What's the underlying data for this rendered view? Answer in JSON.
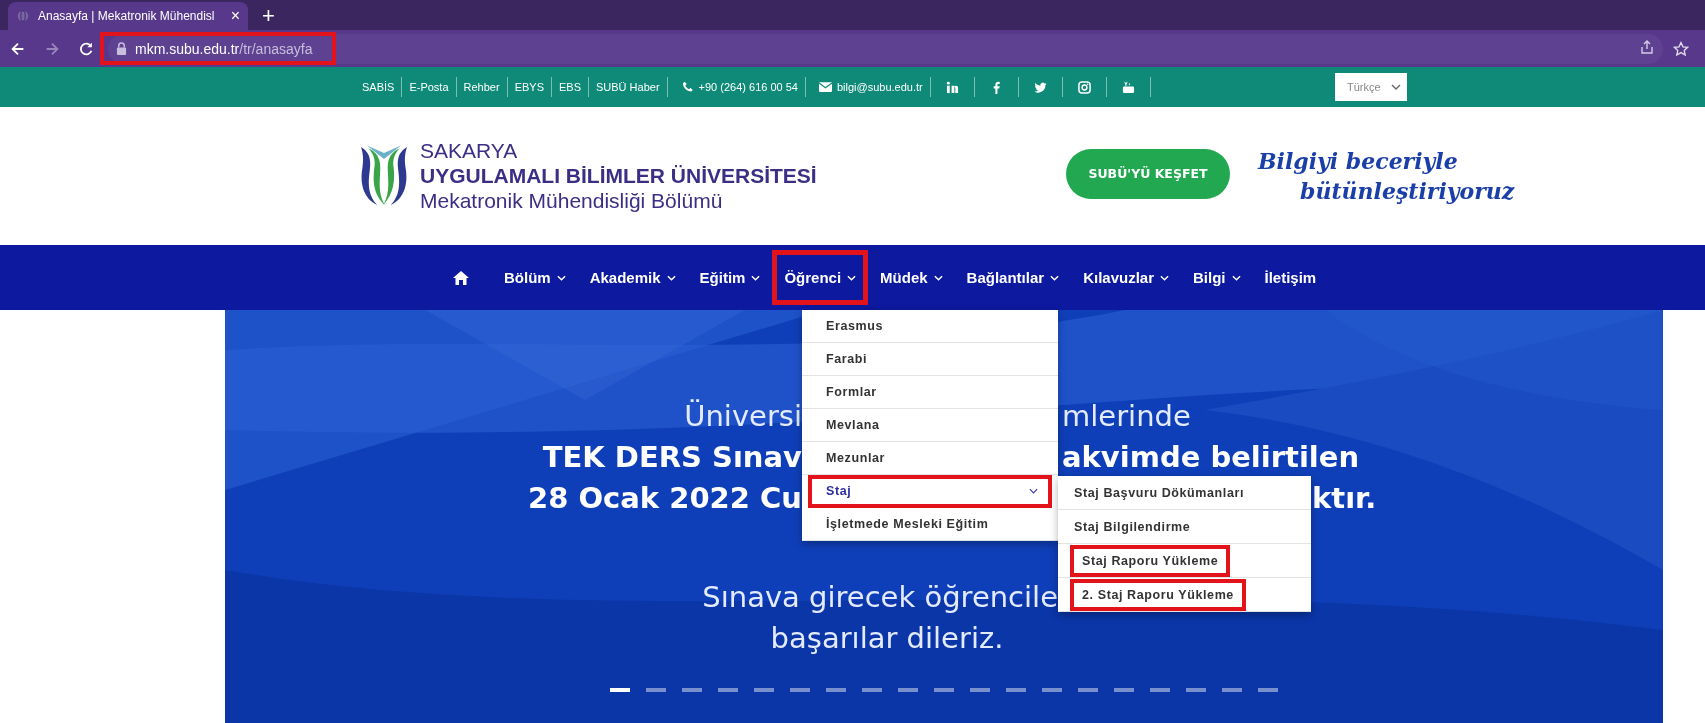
{
  "browser": {
    "tab": {
      "title": "Anasayfa | Mekatronik Mühendisl",
      "close": "×"
    },
    "new_tab": "+",
    "nav_buttons": [
      {
        "kind": "back",
        "disabled": false
      },
      {
        "kind": "forward",
        "disabled": true
      },
      {
        "kind": "reload",
        "disabled": false
      }
    ],
    "url": {
      "host": "mkm.subu.edu.tr",
      "path": "/tr/anasayfa",
      "highlighted": true
    }
  },
  "topbar": {
    "links": [
      "SABİS",
      "E-Posta",
      "Rehber",
      "EBYS",
      "EBS",
      "SUBÜ Haber"
    ],
    "phone": "+90 (264) 616 00 54",
    "email": "bilgi@subu.edu.tr",
    "social": [
      {
        "kind": "linkedin"
      },
      {
        "kind": "facebook"
      },
      {
        "kind": "twitter"
      },
      {
        "kind": "instagram"
      },
      {
        "kind": "youtube"
      }
    ],
    "language": "Türkçe"
  },
  "header": {
    "line1": "SAKARYA",
    "line2": "UYGULAMALI BİLİMLER ÜNİVERSİTESİ",
    "department": "Mekatronik Mühendisliği Bölümü",
    "button": "SUBÜ'YÜ KEŞFET",
    "slogan": [
      "Bilgiyi beceriyle",
      "bütünleştiriyoruz"
    ]
  },
  "nav": [
    {
      "kind": "home"
    },
    {
      "kind": "menu",
      "label": "Bölüm",
      "highlighted": false
    },
    {
      "kind": "menu",
      "label": "Akademik",
      "highlighted": false
    },
    {
      "kind": "menu",
      "label": "Eğitim",
      "highlighted": false
    },
    {
      "kind": "menu",
      "label": "Öğrenci",
      "highlighted": true
    },
    {
      "kind": "menu",
      "label": "Müdek",
      "highlighted": false
    },
    {
      "kind": "menu",
      "label": "Bağlantılar",
      "highlighted": false
    },
    {
      "kind": "menu",
      "label": "Kılavuzlar",
      "highlighted": false
    },
    {
      "kind": "menu",
      "label": "Bilgi",
      "highlighted": false
    },
    {
      "kind": "link",
      "label": "İletişim",
      "highlighted": false
    }
  ],
  "dropdown": [
    {
      "label": "Erasmus",
      "selected": false,
      "highlighted": false
    },
    {
      "label": "Farabi",
      "selected": false,
      "highlighted": false
    },
    {
      "label": "Formlar",
      "selected": false,
      "highlighted": false
    },
    {
      "label": "Mevlana",
      "selected": false,
      "highlighted": false
    },
    {
      "label": "Mezunlar",
      "selected": false,
      "highlighted": false
    },
    {
      "label": "Staj",
      "selected": true,
      "highlighted": true,
      "expanded": true
    },
    {
      "label": "İşletmede Mesleki Eğitim",
      "selected": false,
      "highlighted": false
    }
  ],
  "submenu": [
    {
      "label": "Staj Başvuru Dökümanları",
      "highlighted": false
    },
    {
      "label": "Staj Bilgilendirme",
      "highlighted": false
    },
    {
      "label": "Staj Raporu Yükleme",
      "highlighted": true
    },
    {
      "label": "2. Staj Raporu Yükleme",
      "highlighted": true
    }
  ],
  "hero": {
    "lines": [
      {
        "kind": "menu_gap",
        "bold": false,
        "left": "Üniversi",
        "right": "mlerinde"
      },
      {
        "kind": "menu_gap",
        "bold": true,
        "left": "TEK DERS Sınav",
        "right": "akvimde belirtilen"
      },
      {
        "kind": "submenu_gap",
        "bold": true,
        "left": "28 Ocak 2022 Cu",
        "right": "ktır."
      },
      {
        "kind": "cut",
        "bold": false,
        "left": "Sınava girecek öğrencile"
      },
      {
        "kind": "center",
        "bold": false,
        "left": "başarılar dileriz."
      }
    ],
    "slides": [
      {
        "selected": true
      },
      {
        "selected": false
      },
      {
        "selected": false
      },
      {
        "selected": false
      },
      {
        "selected": false
      },
      {
        "selected": false
      },
      {
        "selected": false
      },
      {
        "selected": false
      },
      {
        "selected": false
      },
      {
        "selected": false
      },
      {
        "selected": false
      },
      {
        "selected": false
      },
      {
        "selected": false
      },
      {
        "selected": false
      },
      {
        "selected": false
      },
      {
        "selected": false
      },
      {
        "selected": false
      },
      {
        "selected": false
      },
      {
        "selected": false
      }
    ]
  }
}
